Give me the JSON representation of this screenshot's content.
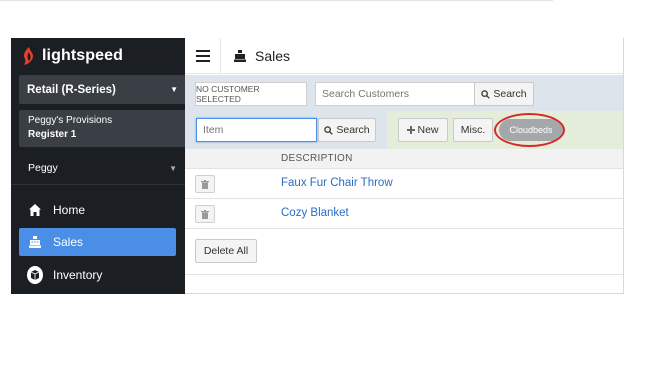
{
  "sidebar": {
    "brand": "lightspeed",
    "store": "Retail (R-Series)",
    "shop_name": "Peggy's Provisions",
    "register": "Register 1",
    "user": "Peggy",
    "nav": [
      {
        "label": "Home",
        "icon": "home-icon"
      },
      {
        "label": "Sales",
        "icon": "cash-register-icon",
        "active": true
      },
      {
        "label": "Inventory",
        "icon": "inventory-icon"
      }
    ]
  },
  "header": {
    "title": "Sales",
    "menu_icon": "hamburger-icon"
  },
  "customer_bar": {
    "no_customer": "NO CUSTOMER SELECTED",
    "search_placeholder": "Search Customers",
    "search_button": "Search"
  },
  "item_bar": {
    "item_placeholder": "Item",
    "search_button": "Search",
    "new_button": "New",
    "misc_button": "Misc.",
    "cloudbeds_button": "Cloudbeds"
  },
  "table": {
    "columns": [
      "",
      "DESCRIPTION"
    ],
    "rows": [
      {
        "description": "Faux Fur Chair Throw"
      },
      {
        "description": "Cozy Blanket"
      }
    ],
    "delete_all": "Delete All"
  },
  "colors": {
    "sidebar_bg": "#1b1e23",
    "active_nav": "#4a8ee8",
    "link": "#2a6cc4",
    "highlight_ring": "#d42a2a"
  }
}
